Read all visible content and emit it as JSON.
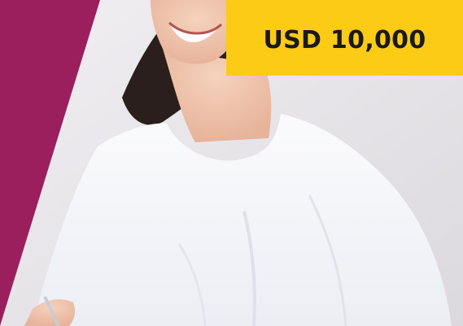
{
  "colors": {
    "panel": "#9b1f5d",
    "price_tag_bg": "#fbcb15",
    "price_tag_text": "#1a1a1a",
    "shirt": "#f8f8fb",
    "hair": "#2a1f1c",
    "skin": "#f0c4ad",
    "background": "#e9e6ea"
  },
  "price_tag": {
    "label": "USD 10,000"
  },
  "photo": {
    "subject": "smiling-woman-in-white-top"
  }
}
